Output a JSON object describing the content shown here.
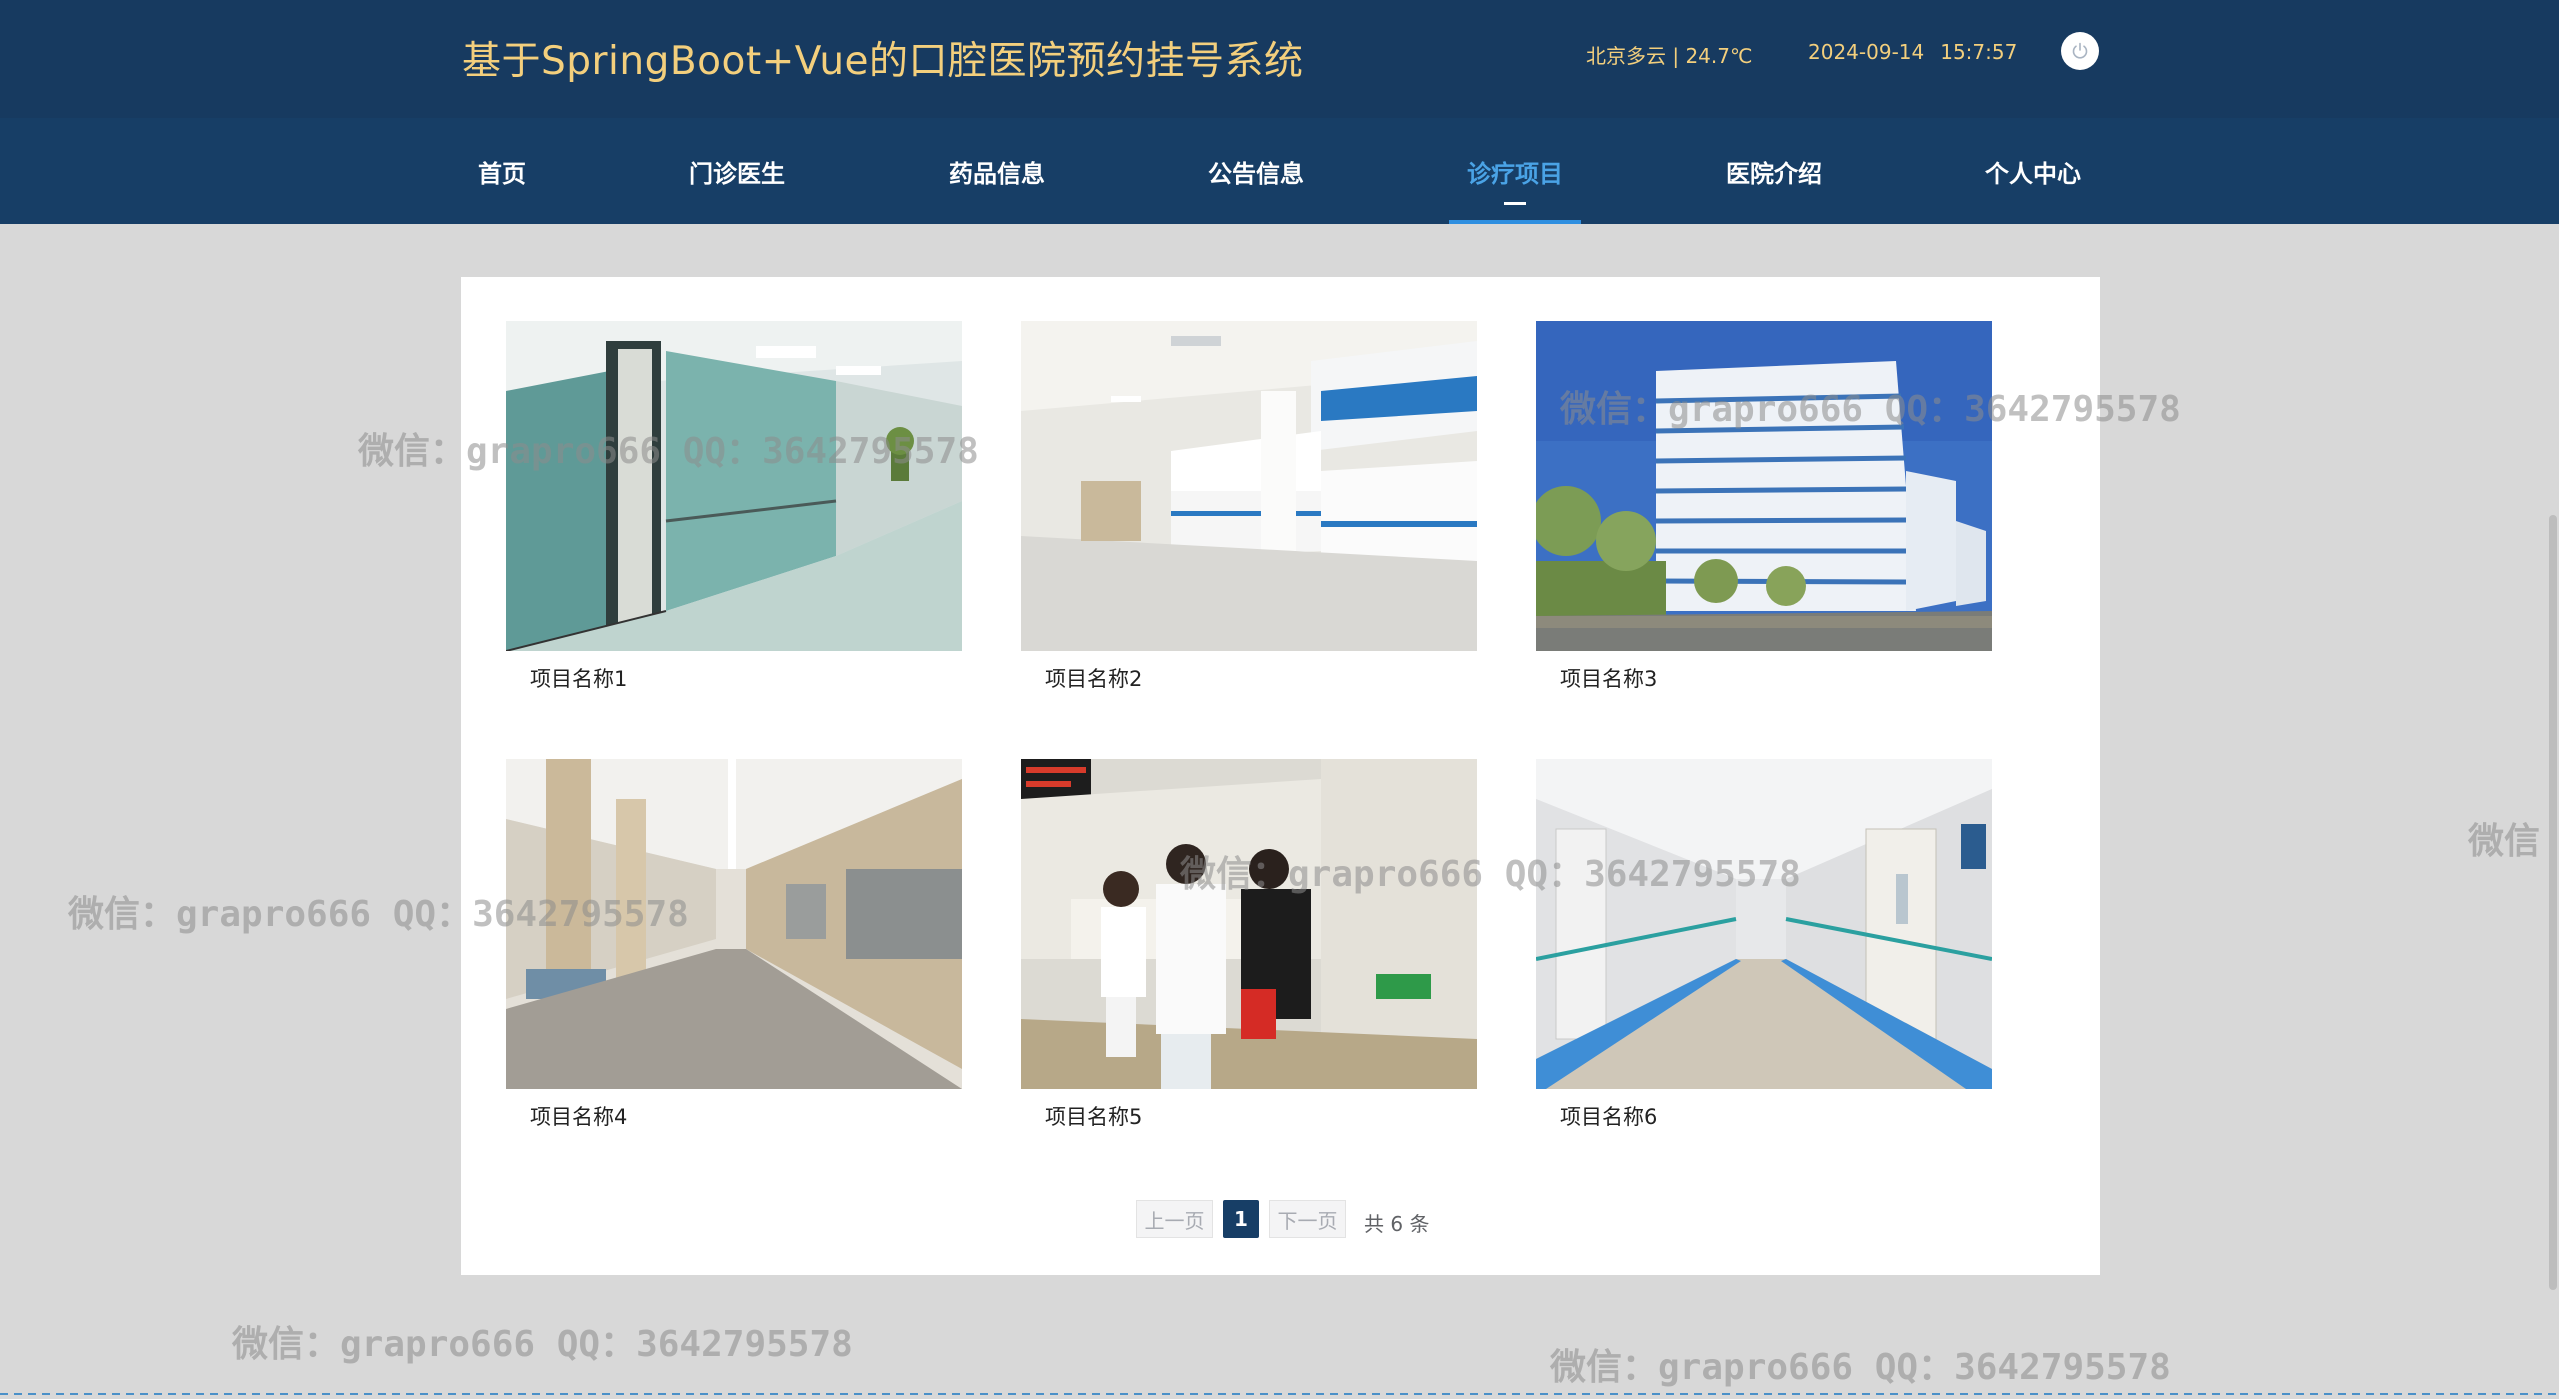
{
  "header": {
    "title": "基于SpringBoot+Vue的口腔医院预约挂号系统",
    "weather": "北京多云 | 24.7℃",
    "date": "2024-09-14",
    "time": "15:7:57",
    "power_icon": "power-icon"
  },
  "nav": {
    "items": [
      {
        "label": "首页"
      },
      {
        "label": "门诊医生"
      },
      {
        "label": "药品信息"
      },
      {
        "label": "公告信息"
      },
      {
        "label": "诊疗项目",
        "active": true
      },
      {
        "label": "医院介绍"
      },
      {
        "label": "个人中心"
      }
    ]
  },
  "projects": [
    {
      "name": "项目名称1"
    },
    {
      "name": "项目名称2"
    },
    {
      "name": "项目名称3"
    },
    {
      "name": "项目名称4"
    },
    {
      "name": "项目名称5"
    },
    {
      "name": "项目名称6"
    }
  ],
  "pager": {
    "prev": "上一页",
    "current": "1",
    "next": "下一页",
    "total": "共 6 条"
  },
  "watermark": "微信：grapro666 QQ：3642795578",
  "watermark_partial": "微信",
  "colors": {
    "header_bg": "#173a60",
    "nav_bg": "#173e66",
    "title": "#f3cf7d",
    "active": "#4aa3e6",
    "page_bg": "#d8d8d8"
  }
}
